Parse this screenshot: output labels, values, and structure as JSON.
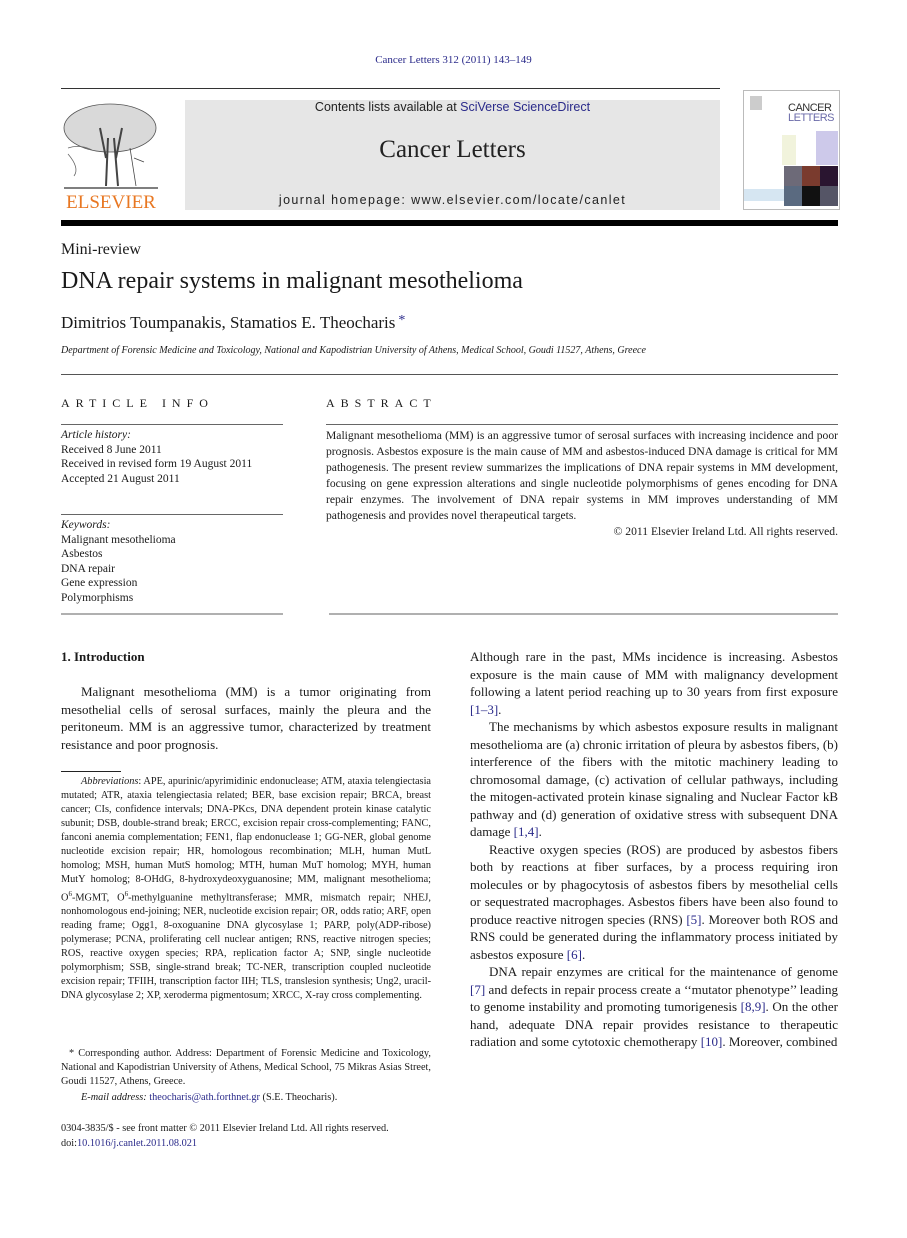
{
  "header": {
    "journal_reference": "Cancer Letters 312 (2011) 143–149",
    "publisher_logo_text": "ELSEVIER",
    "contents_prefix": "Contents lists available at ",
    "contents_link": "SciVerse ScienceDirect",
    "journal_name": "Cancer Letters",
    "homepage_line": "journal homepage: www.elsevier.com/locate/canlet",
    "cover_title_line1": "CANCER",
    "cover_title_line2": "LETTERS",
    "colors": {
      "logo_orange": "#e87722",
      "link_blue": "#2a2a8a",
      "banner_gray": "#e6e6e6"
    }
  },
  "article": {
    "type": "Mini-review",
    "title": "DNA repair systems in malignant mesothelioma",
    "authors": "Dimitrios Toumpanakis, Stamatios E. Theocharis",
    "corresponding_marker": "*",
    "affiliation": "Department of Forensic Medicine and Toxicology, National and Kapodistrian University of Athens, Medical School, Goudi 11527, Athens, Greece"
  },
  "article_info": {
    "heading": "ARTICLE INFO",
    "history_label": "Article history:",
    "history": [
      "Received 8 June 2011",
      "Received in revised form 19 August 2011",
      "Accepted 21 August 2011"
    ],
    "keywords_label": "Keywords:",
    "keywords": [
      "Malignant mesothelioma",
      "Asbestos",
      "DNA repair",
      "Gene expression",
      "Polymorphisms"
    ]
  },
  "abstract": {
    "heading": "ABSTRACT",
    "text": "Malignant mesothelioma (MM) is an aggressive tumor of serosal surfaces with increasing incidence and poor prognosis. Asbestos exposure is the main cause of MM and asbestos-induced DNA damage is critical for MM pathogenesis. The present review summarizes the implications of DNA repair systems in MM development, focusing on gene expression alterations and single nucleotide polymorphisms of genes encoding for DNA repair enzymes. The involvement of DNA repair systems in MM improves understanding of MM pathogenesis and provides novel therapeutical targets.",
    "copyright": "© 2011 Elsevier Ireland Ltd. All rights reserved."
  },
  "introduction": {
    "heading": "1. Introduction",
    "p1": "Malignant mesothelioma (MM) is a tumor originating from mesothelial cells of serosal surfaces, mainly the pleura and the peritoneum. MM is an aggressive tumor, characterized by treatment resistance and poor prognosis.",
    "right_p1_text": "Although rare in the past, MMs incidence is increasing. Asbestos exposure is the main cause of MM with malignancy development following a latent period reaching up to 30 years from first exposure ",
    "right_p1_ref": "[1–3]",
    "right_p2_text": "The mechanisms by which asbestos exposure results in malignant mesothelioma are (a) chronic irritation of pleura by asbestos fibers, (b) interference of the fibers with the mitotic machinery leading to chromosomal damage, (c) activation of cellular pathways, including the mitogen-activated protein kinase signaling and Nuclear Factor kB pathway and (d) generation of oxidative stress with subsequent DNA damage ",
    "right_p2_ref": "[1,4]",
    "right_p3_a": "Reactive oxygen species (ROS) are produced by asbestos fibers both by reactions at fiber surfaces, by a process requiring iron molecules or by phagocytosis of asbestos fibers by mesothelial cells or sequestrated macrophages. Asbestos fibers have been also found to produce reactive nitrogen species (RNS) ",
    "right_p3_ref1": "[5]",
    "right_p3_b": ". Moreover both ROS and RNS could be generated during the inflammatory process initiated by asbestos exposure ",
    "right_p3_ref2": "[6]",
    "right_p4_a": "DNA repair enzymes are critical for the maintenance of genome ",
    "right_p4_ref1": "[7]",
    "right_p4_b": " and defects in repair process create a ‘‘mutator phenotype’’ leading to genome instability and promoting tumorigenesis ",
    "right_p4_ref2": "[8,9]",
    "right_p4_c": ". On the other hand, adequate DNA repair provides resistance to therapeutic radiation and some cytotoxic chemotherapy ",
    "right_p4_ref3": "[10]",
    "right_p4_d": ". Moreover, combined"
  },
  "footnotes": {
    "abbrev_label": "Abbreviations",
    "abbrev_part1": ": APE, apurinic/apyrimidinic endonuclease; ATM, ataxia telengiectasia mutated; ATR, ataxia telengiectasia related; BER, base excision repair; BRCA, breast cancer; CIs, confidence intervals; DNA-PKcs, DNA dependent protein kinase catalytic subunit; DSB, double-strand break; ERCC, excision repair cross-complementing; FANC, fanconi anemia complementation; FEN1, flap endonuclease 1; GG-NER, global genome nucleotide excision repair; HR, homologous recombination; MLH, human MutL homolog; MSH, human MutS homolog; MTH, human MuT homolog; MYH, human MutY homolog; 8-OHdG, 8-hydroxydeoxyguanosine; MM, malignant mesothelioma; O",
    "abbrev_sup": "6",
    "abbrev_part2": "-MGMT, O",
    "abbrev_part3": "-methylguanine methyltransferase; MMR, mismatch repair; NHEJ, nonhomologous end-joining; NER, nucleotide excision repair; OR, odds ratio; ARF, open reading frame; Ogg1, 8-oxoguanine DNA glycosylase 1; PARP, poly(ADP-ribose) polymerase; PCNA, proliferating cell nuclear antigen; RNS, reactive nitrogen species; ROS, reactive oxygen species; RPA, replication factor A; SNP, single nucleotide polymorphism; SSB, single-strand break; TC-NER, transcription coupled nucleotide excision repair; TFIIH, transcription factor IIH; TLS, translesion synthesis; Ung2, uracil-DNA glycosylase 2; XP, xeroderma pigmentosum; XRCC, X-ray cross complementing.",
    "corresponding": "* Corresponding author. Address: Department of Forensic Medicine and Toxicology, National and Kapodistrian University of Athens, Medical School, 75 Mikras Asias Street, Goudi 11527, Athens, Greece.",
    "email_label": "E-mail address:",
    "email": "theocharis@ath.forthnet.gr",
    "email_suffix": " (S.E. Theocharis).",
    "front_matter": "0304-3835/$ - see front matter © 2011 Elsevier Ireland Ltd. All rights reserved.",
    "doi_label": "doi:",
    "doi": "10.1016/j.canlet.2011.08.021"
  }
}
